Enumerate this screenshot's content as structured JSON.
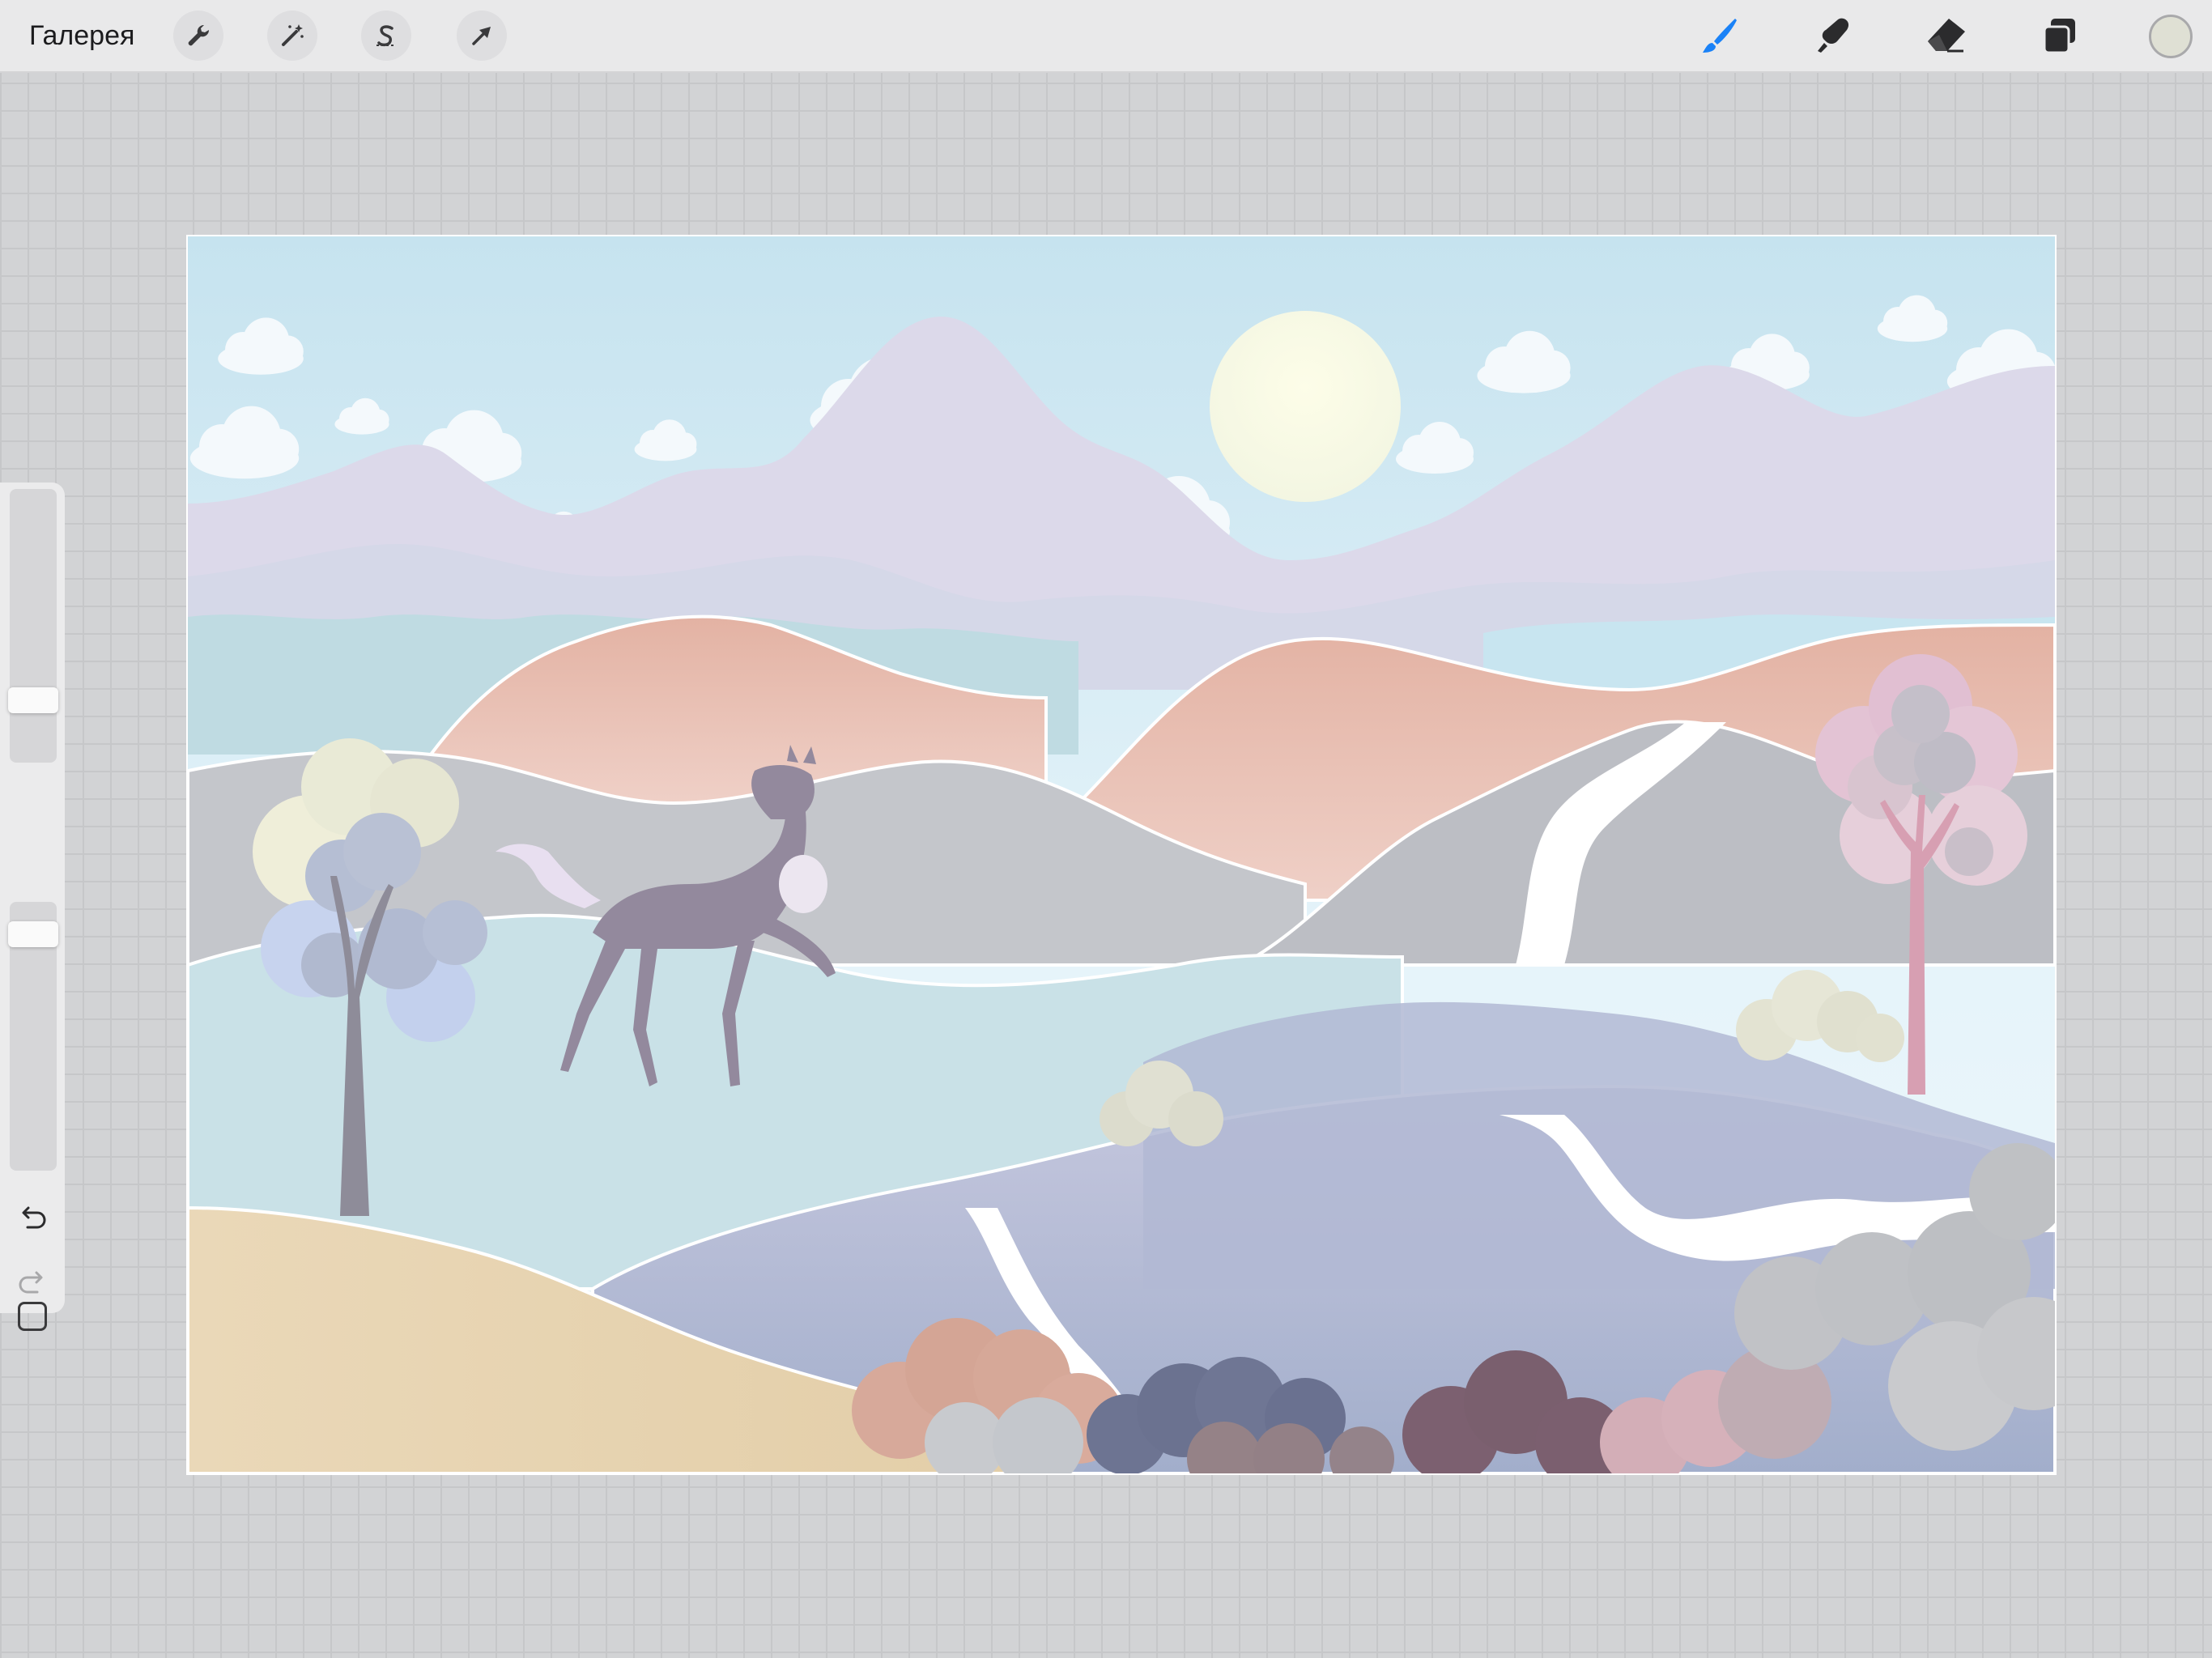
{
  "toolbar": {
    "gallery_label": "Галерея",
    "left_tools": [
      {
        "name": "actions",
        "icon": "wrench-icon"
      },
      {
        "name": "adjustments",
        "icon": "magic-wand-icon"
      },
      {
        "name": "selection",
        "icon": "selection-s-icon"
      },
      {
        "name": "transform",
        "icon": "arrow-cursor-icon"
      }
    ],
    "right_tools": [
      {
        "name": "brush",
        "icon": "brush-icon",
        "active": true
      },
      {
        "name": "smudge",
        "icon": "smudge-finger-icon",
        "active": false
      },
      {
        "name": "eraser",
        "icon": "eraser-icon",
        "active": false
      },
      {
        "name": "layers",
        "icon": "layers-icon",
        "active": false
      }
    ],
    "active_color": "#dfe0d4",
    "accent_color": "#1a82f7"
  },
  "sidebar": {
    "brush_size": 0.2,
    "brush_opacity": 0.92,
    "modify_button": "square-icon",
    "undo": "undo-arrow-icon",
    "redo": "redo-arrow-icon"
  },
  "artwork": {
    "description_icon": "landscape-illustration",
    "sky_colors": [
      "#c8e4f0",
      "#e8f5fb"
    ]
  }
}
